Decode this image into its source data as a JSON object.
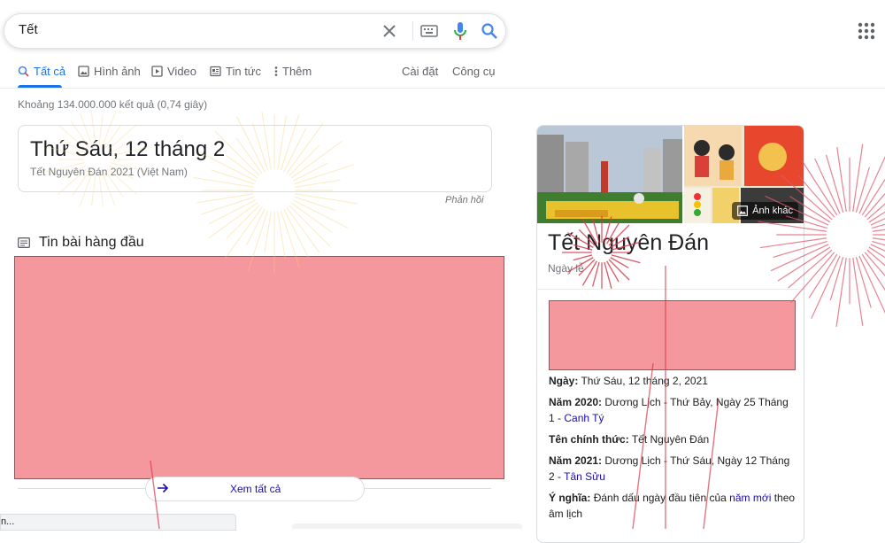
{
  "search": {
    "query": "Tết"
  },
  "tabs": [
    {
      "label": "Tất cả",
      "icon": "search-icon",
      "active": true
    },
    {
      "label": "Hình ảnh",
      "icon": "image-icon",
      "active": false
    },
    {
      "label": "Video",
      "icon": "video-icon",
      "active": false
    },
    {
      "label": "Tin tức",
      "icon": "news-icon",
      "active": false
    },
    {
      "label": "Thêm",
      "icon": "more-vert-icon",
      "active": false
    }
  ],
  "tools": {
    "settings": "Cài đặt",
    "tools": "Công cụ"
  },
  "result_stats": "Khoảng 134.000.000 kết quả (0,74 giây)",
  "answer": {
    "date": "Thứ Sáu, 12 tháng 2",
    "subtitle": "Tết Nguyên Đán 2021 (Việt Nam)",
    "feedback": "Phản hồi"
  },
  "news": {
    "heading": "Tin bài hàng đầu",
    "see_all": "Xem tất cả"
  },
  "status_bar": "n...",
  "knowledge_panel": {
    "more_images": "Ảnh khác",
    "title": "Tết Nguyên Đán",
    "subtitle": "Ngày lễ",
    "facts": [
      {
        "label": "Ngày:",
        "value": "Thứ Sáu, 12 tháng 2, 2021"
      },
      {
        "label": "Năm 2020:",
        "value": "Dương Lịch - Thứ Bảy, Ngày 25 Tháng 1 -",
        "link": "Canh Tý"
      },
      {
        "label": "Tên chính thức:",
        "value": "Tết Nguyên Đán"
      },
      {
        "label": "Năm 2021:",
        "value": "Dương Lịch - Thứ Sáu, Ngày 12 Tháng 2 -",
        "link": "Tân Sửu"
      },
      {
        "label": "Ý nghĩa:",
        "value": "Đánh dấu ngày đầu tiên của",
        "link": "năm mới",
        "tail": "theo âm lịch"
      }
    ]
  },
  "colors": {
    "accent": "#1a73e8",
    "link": "#1a0dab",
    "redaction": "#f5989d"
  }
}
